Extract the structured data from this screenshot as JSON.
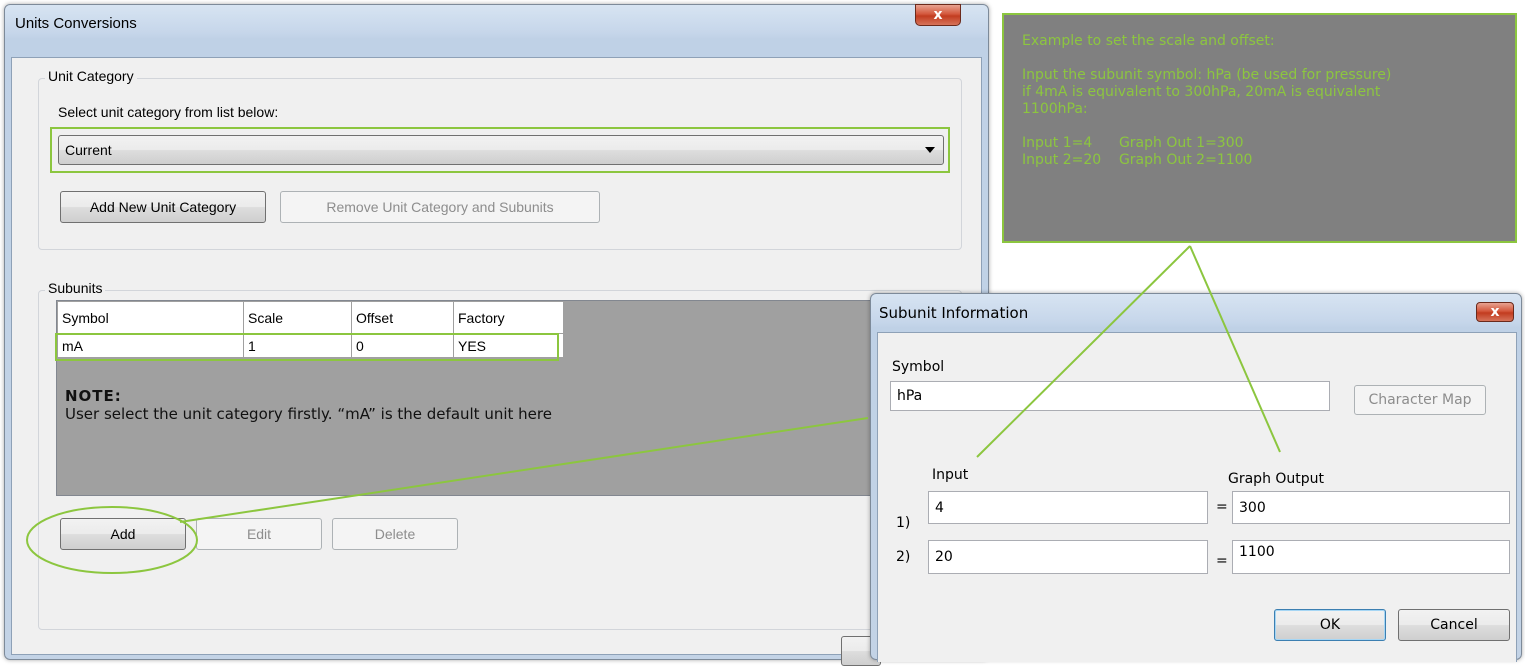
{
  "main_window": {
    "title": "Units Conversions",
    "close_label": "x",
    "unit_category": {
      "group_label": "Unit Category",
      "instruction": "Select unit category from list below:",
      "selected": "Current",
      "add_button": "Add New Unit Category",
      "remove_button": "Remove Unit Category and Subunits"
    },
    "subunits": {
      "group_label": "Subunits",
      "columns": [
        "Symbol",
        "Scale",
        "Offset",
        "Factory"
      ],
      "rows": [
        [
          "mA",
          "1",
          "0",
          "YES"
        ]
      ],
      "note_title": "NOTE:",
      "note_text": "User select the unit category firstly. “mA” is the default unit here",
      "add_button": "Add",
      "edit_button": "Edit",
      "delete_button": "Delete"
    }
  },
  "callout": {
    "text": "Example to set the scale and offset:\n\nInput the subunit symbol: hPa (be used for pressure)\nif 4mA is equivalent to 300hPa, 20mA is equivalent\n1100hPa:\n\nInput 1=4      Graph Out 1=300\nInput 2=20    Graph Out 2=1100"
  },
  "subunit_dialog": {
    "title": "Subunit Information",
    "close_label": "x",
    "symbol_label": "Symbol",
    "symbol_value": "hPa",
    "char_map_button": "Character Map",
    "input_header": "Input",
    "output_header": "Graph Output",
    "rows": [
      {
        "index": "1)",
        "input": "4",
        "equals": "=",
        "output": "300"
      },
      {
        "index": "2)",
        "input": "20",
        "equals": "=",
        "output": "1100"
      }
    ],
    "ok_button": "OK",
    "cancel_button": "Cancel"
  },
  "colors": {
    "annotation_green": "#8cc63f",
    "callout_bg": "#808080"
  }
}
